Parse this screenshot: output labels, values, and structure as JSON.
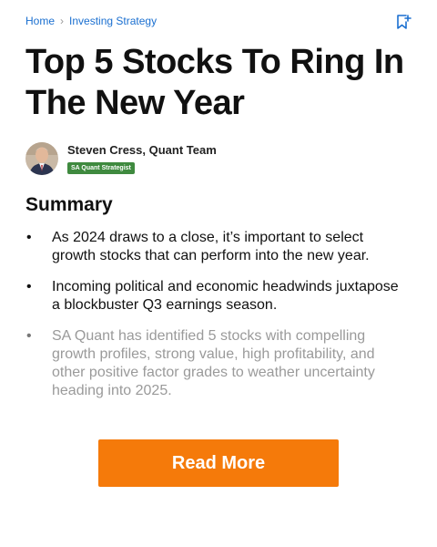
{
  "breadcrumb": {
    "home": "Home",
    "separator": "›",
    "section": "Investing Strategy"
  },
  "article": {
    "title": "Top 5 Stocks To Ring In The New Year",
    "author_name": "Steven Cress, Quant Team",
    "author_badge": "SA Quant Strategist"
  },
  "summary": {
    "heading": "Summary",
    "bullets": [
      "As 2024 draws to a close, it’s important to select growth stocks that can perform into the new year.",
      "Incoming political and economic headwinds juxtapose a blockbuster Q3 earnings season.",
      "SA Quant has identified 5 stocks with compelling growth profiles, strong value, high profitability, and other positive factor grades to weather uncertainty heading into 2025."
    ]
  },
  "cta": {
    "read_more": "Read More"
  },
  "icons": {
    "bookmark": "bookmark-add-icon",
    "bullet": "•"
  },
  "colors": {
    "link": "#1a6fd0",
    "badge": "#3f8a3f",
    "cta": "#f57a0a"
  }
}
